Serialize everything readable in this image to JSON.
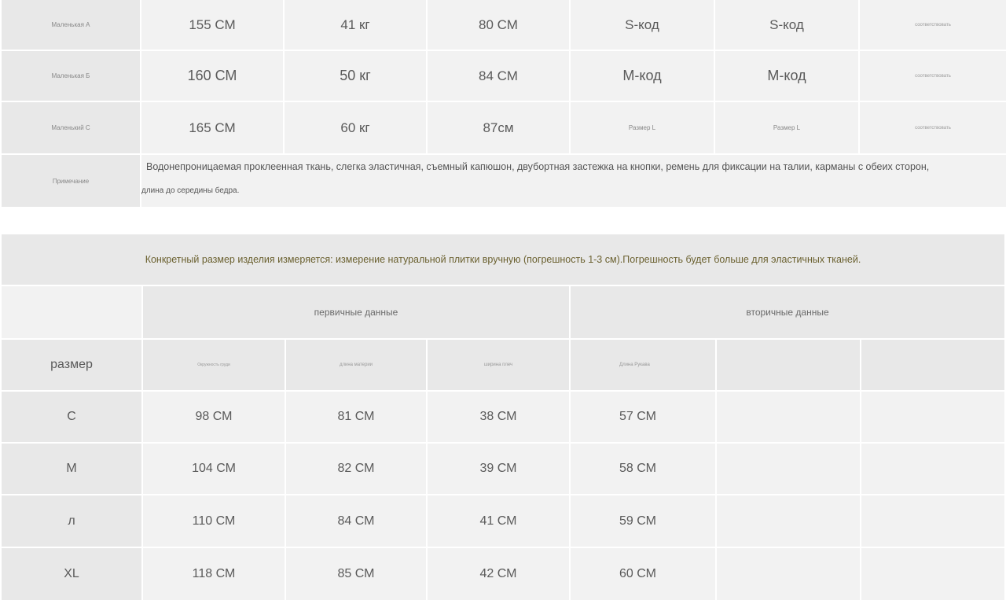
{
  "top_table": {
    "rows": [
      {
        "label": "Маленькая А",
        "height": "155 СМ",
        "weight": "41 кг",
        "bust": "80 СМ",
        "size1": "S-код",
        "size2": "S-код",
        "match": "соответствовать"
      },
      {
        "label": "Маленькая Б",
        "height": "160 СМ",
        "weight": "50 кг",
        "bust": "84 СМ",
        "size1": "M-код",
        "size2": "M-код",
        "match": "соответствовать"
      },
      {
        "label": "Маленький С",
        "height": "165 СМ",
        "weight": "60 кг",
        "bust": "87см",
        "size1": "Размер L",
        "size2": "Размер L",
        "match": "соответствовать"
      }
    ],
    "note_label": "Примечание",
    "note_line1": "Водонепроницаемая проклеенная ткань, слегка эластичная, съемный капюшон, двубортная застежка на кнопки, ремень для фиксации на талии, карманы с обеих сторон,",
    "note_line2": "длина до середины бедра."
  },
  "banner": "Конкретный размер изделия измеряется: измерение натуральной плитки вручную (погрешность 1-3 см).Погрешность будет больше для эластичных тканей.",
  "size_table": {
    "group_primary": "первичные данные",
    "group_secondary": "вторичные данные",
    "size_header": "размер",
    "columns": [
      "Окружность груди",
      "длина материи",
      "ширина плеч",
      "Длина Рукава",
      "",
      ""
    ],
    "rows": [
      {
        "size": "С",
        "values": [
          "98 СМ",
          "81 СМ",
          "38 СМ",
          "57 СМ",
          "",
          ""
        ]
      },
      {
        "size": "M",
        "values": [
          "104 СМ",
          "82 СМ",
          "39 СМ",
          "58 СМ",
          "",
          ""
        ]
      },
      {
        "size": "л",
        "values": [
          "110 СМ",
          "84 СМ",
          "41 СМ",
          "59 СМ",
          "",
          ""
        ]
      },
      {
        "size": "XL",
        "values": [
          "118 СМ",
          "85 СМ",
          "42 СМ",
          "60 СМ",
          "",
          ""
        ]
      }
    ]
  }
}
